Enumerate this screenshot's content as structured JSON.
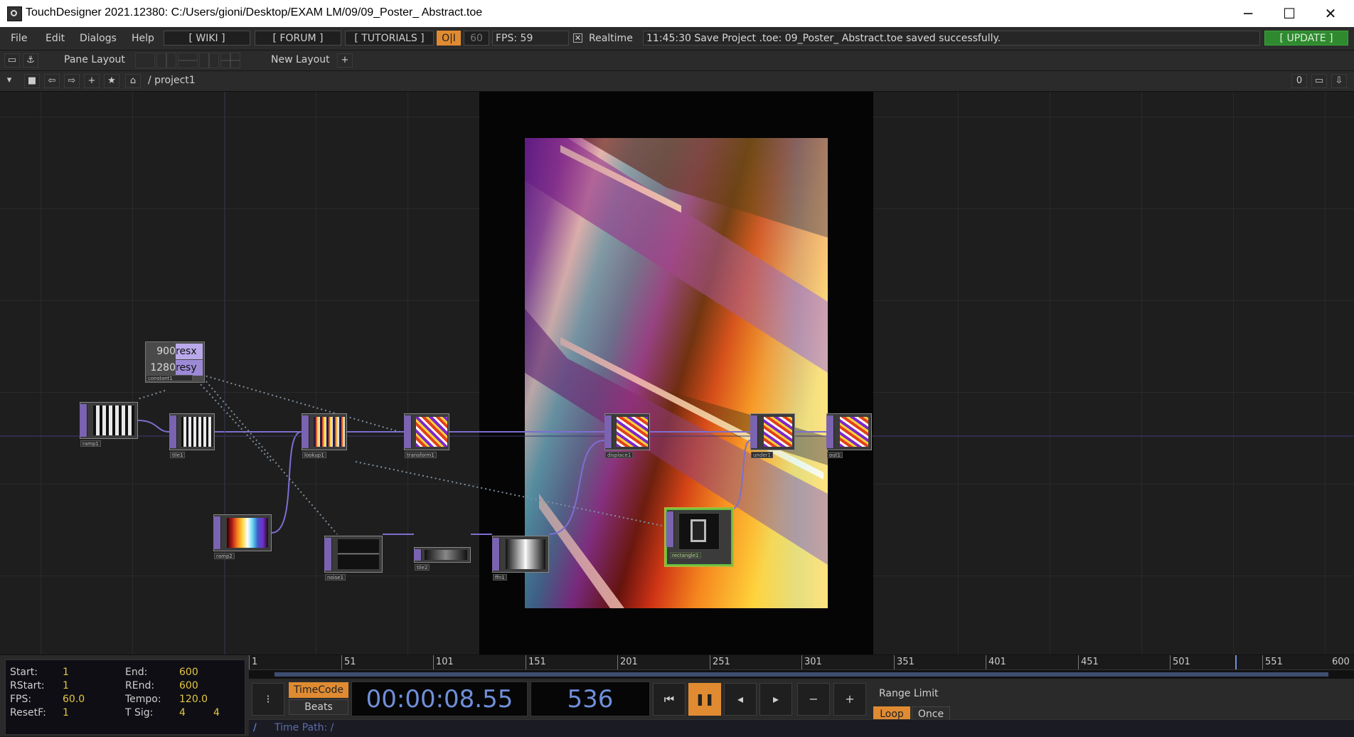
{
  "window": {
    "title": "TouchDesigner 2021.12380: C:/Users/gioni/Desktop/EXAM LM/09/09_Poster_ Abstract.toe",
    "minimize": "─",
    "maximize": "☐",
    "close": "✕"
  },
  "menubar": {
    "items": [
      "File",
      "Edit",
      "Dialogs",
      "Help"
    ],
    "wiki": "[ WIKI ]",
    "forum": "[ FORUM ]",
    "tutorials": "[ TUTORIALS ]",
    "oi": "O|I",
    "fps_cap": "60",
    "fps_display": "FPS:  59",
    "realtime_label": "Realtime",
    "status_message": "11:45:30 Save Project .toe: 09_Poster_ Abstract.toe saved successfully.",
    "update": "[ UPDATE ]"
  },
  "panebar": {
    "pane_layout": "Pane Layout",
    "new_layout": "New Layout",
    "add": "+"
  },
  "pathbar": {
    "path": "/ project1",
    "counter": "0"
  },
  "constant_node": {
    "rows": [
      {
        "value": "900",
        "name": "resx"
      },
      {
        "value": "1280",
        "name": "resy"
      }
    ],
    "label": "constant1"
  },
  "nodes": [
    {
      "label": "ramp1"
    },
    {
      "label": "tile1"
    },
    {
      "label": "lookup1"
    },
    {
      "label": "transform1"
    },
    {
      "label": "displace1"
    },
    {
      "label": "under1"
    },
    {
      "label": "out1"
    },
    {
      "label": "ramp2"
    },
    {
      "label": "noise1"
    },
    {
      "label": "tile2"
    },
    {
      "label": "ffn1"
    },
    {
      "label": "rectangle1"
    }
  ],
  "timeline": {
    "info": {
      "start_label": "Start:",
      "start": "1",
      "end_label": "End:",
      "end": "600",
      "rstart_label": "RStart:",
      "rstart": "1",
      "rend_label": "REnd:",
      "rend": "600",
      "fps_label": "FPS:",
      "fps": "60.0",
      "tempo_label": "Tempo:",
      "tempo": "120.0",
      "resetf_label": "ResetF:",
      "resetf": "1",
      "tsig_label": "T Sig:",
      "tsig_a": "4",
      "tsig_b": "4"
    },
    "ruler_ticks": [
      "1",
      "51",
      "101",
      "151",
      "201",
      "251",
      "301",
      "351",
      "401",
      "451",
      "501",
      "551",
      "600"
    ],
    "timecode_btn": "TimeCode",
    "beats_btn": "Beats",
    "timecode": "00:00:08.55",
    "frame": "536",
    "range_limit": "Range Limit",
    "loop": "Loop",
    "once": "Once",
    "time_path": "Time Path: /",
    "slash": "/"
  },
  "colors": {
    "accent_orange": "#e08b32",
    "operator_purple": "#7a63b0",
    "update_green": "#2f8a2f",
    "timecode_blue": "#6f8fd8"
  }
}
